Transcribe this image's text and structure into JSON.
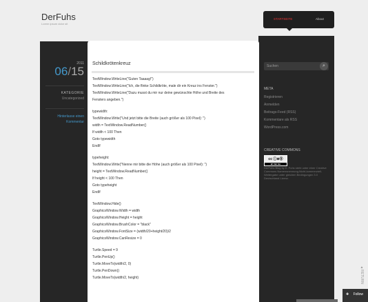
{
  "site": {
    "title": "DerFuhs",
    "description": "Lorem ipsum dolor sit"
  },
  "nav": {
    "items": [
      {
        "label": "STARTSEITE"
      },
      {
        "label": "About"
      }
    ]
  },
  "post": {
    "year": "2011",
    "month": "06",
    "day": "15",
    "category_heading": "KATEGORIE",
    "category": "Uncategorized",
    "comment_link_line1": "Hinterlasse einen",
    "comment_link_line2": "Kommentar",
    "title": "Schildkrötenkreuz",
    "lines": [
      "TextWindow.WriteLine(\"Guten Taaaag!\")",
      "TextWindow.WriteLine(\"Ich, die flinke Schildkröte, male dir ein Kreuz ins Fenster.\")",
      "TextWindow.WriteLine(\"Dazu musst du mir nur deine gewünschte Höhe und Breite des",
      "Fensters angeben.\")",
      "",
      "typewidth:",
      "TextWindow.Write(\"Und jetzt bitte die Breite (auch größer als 100 Pixel): \")",
      "width = TextWindow.ReadNumber()",
      "If width < 100 Then",
      "Goto typewidth",
      "EndIf",
      "",
      "typeheight:",
      "TextWindow.Write(\"Nenne mir bitte die Höhe (auch größer als 100 Pixel): \")",
      "height = TextWindow.ReadNumber()",
      "If height < 100 Then",
      "Goto typeheight",
      "EndIf",
      "",
      "TextWindow.Hide()",
      "GraphicsWindow.Width = width",
      "GraphicsWindow.Height = height",
      "GraphicsWindow.BrushColor = \"black\"",
      "GraphicsWindow.FontSize = (width/20+height/20)/2",
      "GraphicsWindow.CanResize = 0",
      "",
      "Turtle.Speed = 9",
      "Turtle.PenUp()",
      "Turtle.MoveTo(width/2, 0)",
      "Turtle.PenDown()",
      "Turtle.MoveTo(width/2, height)"
    ]
  },
  "sidebar": {
    "search_placeholder": "Suchen",
    "meta_heading": "META",
    "meta_links": [
      "Registrieren",
      "Anmelden",
      "Beitrags-Feed (RSS)",
      "Kommentare als RSS",
      "WordPress.com"
    ],
    "cc_heading": "CREATIVE COMMONS",
    "cc_badge_text": "cc ⓘ⊜⓪",
    "cc_badge_small": "BY   NC   SA",
    "cc_text": "DerFuhs Blog by K. Fuhs steht unter einer Creative Commons Namensnennung-Nicht-kommerziell-Weitergabe unter gleichen Bedingungen 3.0 Deutschland Lizenz."
  },
  "footer": {
    "return_top": "RETURN",
    "follow": "Follow"
  },
  "colors": {
    "accent_blue": "#4499cc",
    "nav_active": "#ee3333",
    "dark_bg": "#262626"
  }
}
